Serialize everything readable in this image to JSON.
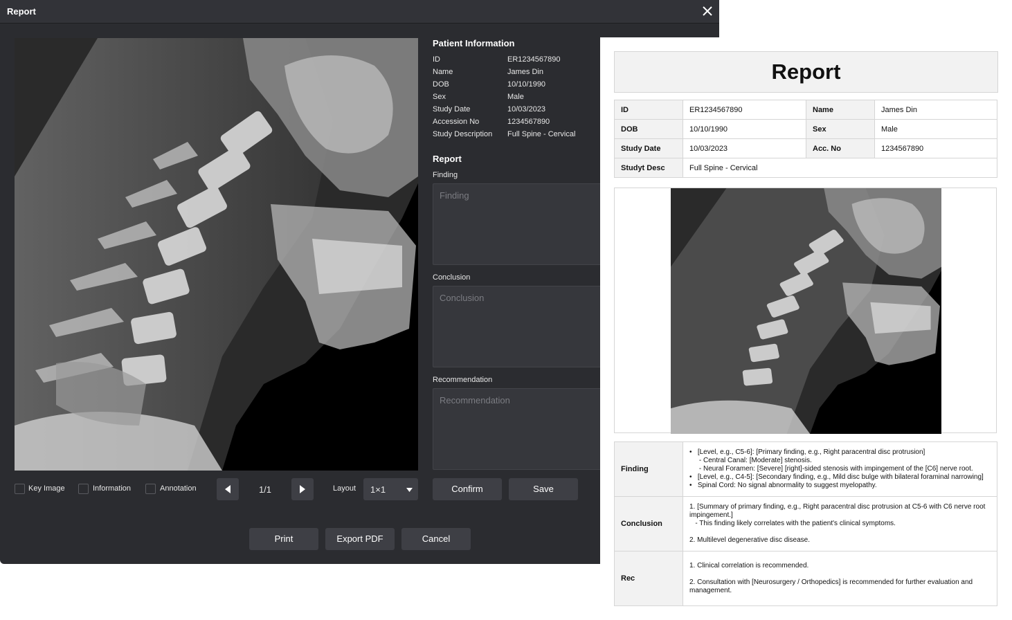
{
  "dialog": {
    "title": "Report",
    "checkboxes": [
      {
        "label": "Key Image",
        "checked": false
      },
      {
        "label": "Information",
        "checked": false
      },
      {
        "label": "Annotation",
        "checked": false
      }
    ],
    "page_indicator": "1/1",
    "layout_label": "Layout",
    "layout_value": "1×1",
    "patient_info": {
      "heading": "Patient Information",
      "rows": [
        {
          "key": "ID",
          "value": "ER1234567890"
        },
        {
          "key": "Name",
          "value": "James Din"
        },
        {
          "key": "DOB",
          "value": "10/10/1990"
        },
        {
          "key": "Sex",
          "value": "Male"
        },
        {
          "key": "Study Date",
          "value": "10/03/2023"
        },
        {
          "key": "Accession No",
          "value": "1234567890"
        },
        {
          "key": "Study Description",
          "value": "Full Spine - Cervical"
        }
      ]
    },
    "report": {
      "heading": "Report",
      "finding_label": "Finding",
      "finding_placeholder": "Finding",
      "conclusion_label": "Conclusion",
      "conclusion_placeholder": "Conclusion",
      "recommendation_label": "Recommendation",
      "recommendation_placeholder": "Recommendation"
    },
    "buttons": {
      "confirm": "Confirm",
      "save": "Save",
      "print": "Print",
      "export_pdf": "Export PDF",
      "cancel": "Cancel"
    }
  },
  "preview": {
    "title": "Report",
    "info": {
      "id_label": "ID",
      "id_value": "ER1234567890",
      "name_label": "Name",
      "name_value": "James Din",
      "dob_label": "DOB",
      "dob_value": "10/10/1990",
      "sex_label": "Sex",
      "sex_value": "Male",
      "study_date_label": "Study Date",
      "study_date_value": "10/03/2023",
      "acc_label": "Acc. No",
      "acc_value": "1234567890",
      "desc_label": "Studyt Desc",
      "desc_value": "Full Spine - Cervical"
    },
    "finding_label": "Finding",
    "finding_lines": [
      "•   [Level, e.g., C5-6]: [Primary finding, e.g., Right paracentral disc protrusion]",
      "     - Central Canal: [Moderate] stenosis.",
      "     - Neural Foramen: [Severe] [right]-sided stenosis with impingement of the [C6] nerve root.",
      "•   [Level, e.g., C4-5]: [Secondary finding, e.g., Mild disc bulge with bilateral foraminal narrowing]",
      "•   Spinal Cord: No signal abnormality to suggest myelopathy."
    ],
    "conclusion_label": "Conclusion",
    "conclusion_lines": [
      "1. [Summary of primary finding, e.g., Right paracentral disc protrusion at C5-6 with C6 nerve root",
      "impingement.]",
      "   - This finding likely correlates with the patient's clinical symptoms.",
      "",
      "2. Multilevel degenerative disc disease."
    ],
    "rec_label": "Rec",
    "rec_lines": [
      "1. Clinical correlation is recommended.",
      "",
      "2. Consultation with [Neurosurgery / Orthopedics] is recommended for further evaluation and",
      "management."
    ]
  },
  "colors": {
    "dialog_bg": "#2b2c30",
    "titlebar_bg": "#323338",
    "button_bg": "#3e3f45",
    "report_header_bg": "#f2f2f2"
  },
  "icons": [
    "close-icon",
    "arrow-left-icon",
    "arrow-right-icon",
    "chevron-down-icon",
    "xray-image"
  ]
}
